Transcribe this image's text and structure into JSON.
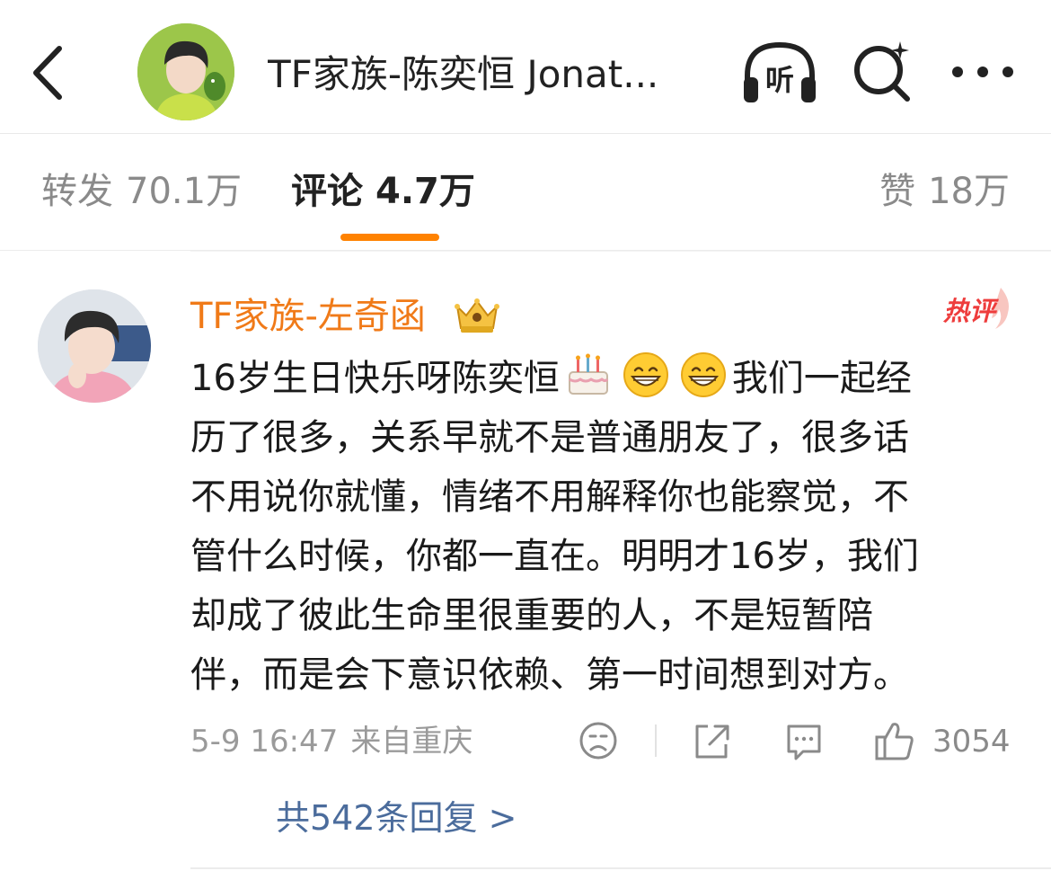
{
  "header": {
    "title": "TF家族-陈奕恒 Jonat...",
    "listen_label": "听"
  },
  "tabs": {
    "repost_label": "转发",
    "repost_count": "70.1万",
    "comment_label": "评论",
    "comment_count": "4.7万",
    "like_label": "赞",
    "like_count": "18万"
  },
  "comment": {
    "author": "TF家族-左奇函",
    "badge": "热评",
    "lines": [
      "16岁生日快乐呀陈奕恒",
      "我们一起经",
      "历了很多，关系早就不是普通朋友了，很多话",
      "不用说你就懂，情绪不用解释你也能察觉，不",
      "管什么时候，你都一直在。明明才16岁，我们",
      "却成了彼此生命里很重要的人，不是短暂陪",
      "伴，而是会下意识依赖、第一时间想到对方。"
    ],
    "emojis": [
      "cake-emoji",
      "grin-emoji",
      "grin-emoji"
    ],
    "time": "5-9 16:47",
    "location": "来自重庆",
    "like_count": "3054",
    "replies_link": "共542条回复 >"
  },
  "colors": {
    "accent": "#ff8200",
    "author": "#f07a18",
    "hot_badge": "#ee3c3c",
    "link": "#4b6c9c",
    "muted": "#9a9a9a"
  },
  "icons": [
    "back-arrow-icon",
    "headphones-icon",
    "search-icon",
    "more-icon",
    "crown-icon",
    "sad-face-icon",
    "share-icon",
    "comment-icon",
    "thumbs-up-icon"
  ]
}
